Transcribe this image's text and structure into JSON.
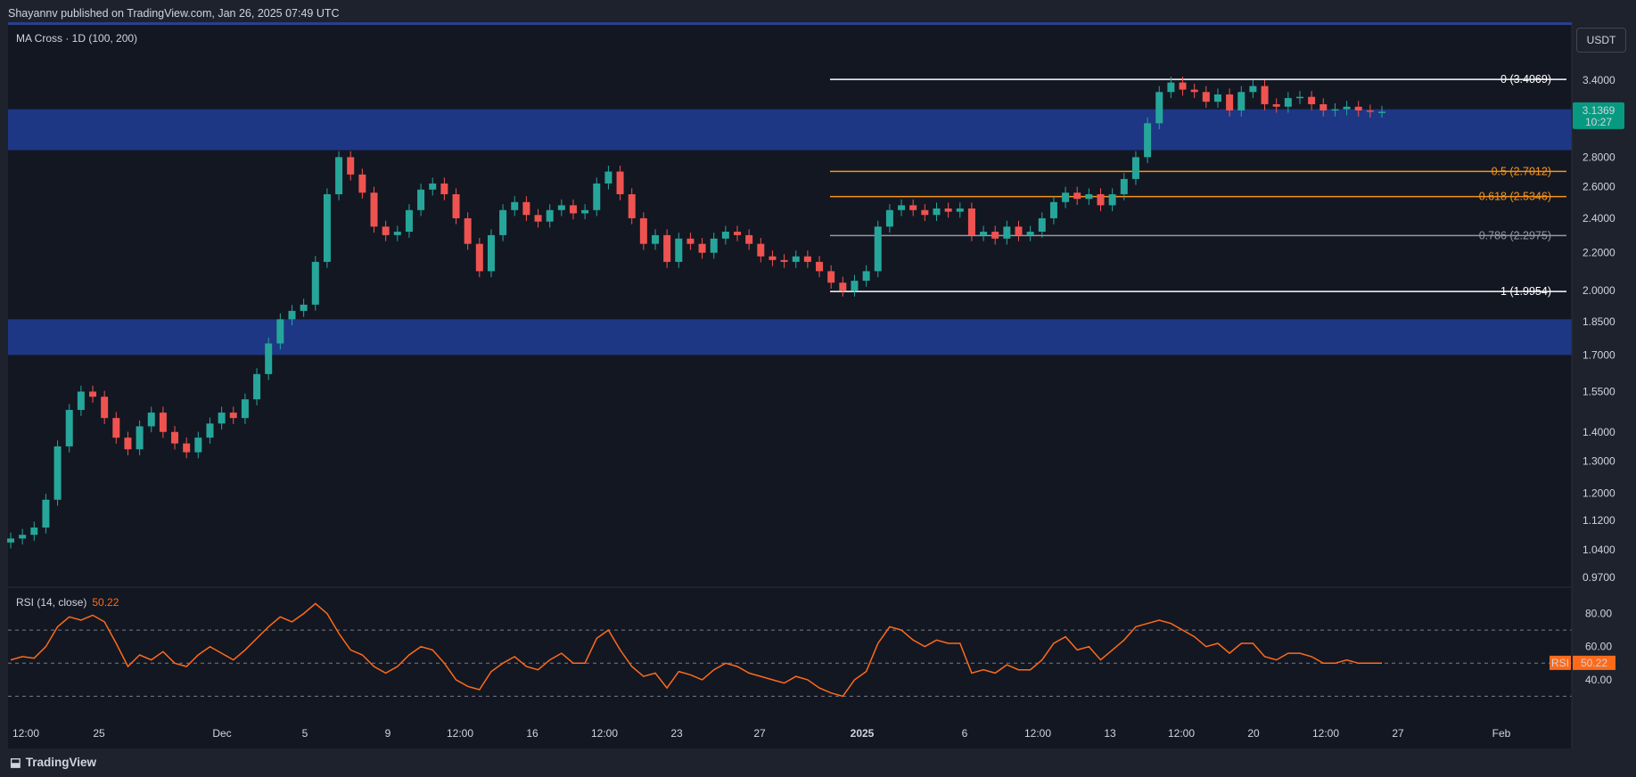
{
  "header": {
    "publish_text": "Shayannv published on TradingView.com, Jan 26, 2025 07:49 UTC"
  },
  "currency_button": "USDT",
  "indicator_label": "MA Cross · 1D (100, 200)",
  "rsi": {
    "label": "RSI (14, close)",
    "value": "50.22",
    "badge_label": "RSI",
    "badge_value": "50.22"
  },
  "footer": {
    "brand": "TradingView"
  },
  "colors": {
    "background": "#131722",
    "panel": "#1e222d",
    "zone": "#1f3b8f",
    "up": "#26a69a",
    "down": "#ef5350",
    "fib_white": "#ffffff",
    "fib_orange": "#f7931a",
    "fib_gray": "#9598a1",
    "rsi_line": "#ff6a1a",
    "price_tag": "#089981"
  },
  "chart_data": {
    "type": "candlestick",
    "price_axis": {
      "ticks": [
        "3.4000",
        "2.8000",
        "2.6000",
        "2.4000",
        "2.2000",
        "2.0000",
        "1.8500",
        "1.7000",
        "1.5500",
        "1.4000",
        "1.3000",
        "1.2000",
        "1.1200",
        "1.0400",
        "0.9700"
      ],
      "scale": "log"
    },
    "time_axis": {
      "ticks": [
        "12:00",
        "25",
        "Dec",
        "5",
        "9",
        "12:00",
        "16",
        "12:00",
        "23",
        "27",
        "2025",
        "6",
        "12:00",
        "13",
        "12:00",
        "20",
        "12:00",
        "27",
        "Feb"
      ]
    },
    "current_price": {
      "value": "3.1369",
      "countdown": "10:27"
    },
    "zones": [
      {
        "name": "resistance-zone",
        "from": 2.85,
        "to": 3.16
      },
      {
        "name": "support-zone",
        "from": 1.7,
        "to": 1.86
      }
    ],
    "fibonacci": [
      {
        "label": "0 (3.4069)",
        "price": 3.4069,
        "color": "white"
      },
      {
        "label": "0.5 (2.7012)",
        "price": 2.7012,
        "color": "orange"
      },
      {
        "label": "0.618 (2.5346)",
        "price": 2.5346,
        "color": "orange"
      },
      {
        "label": "0.786 (2.2975)",
        "price": 2.2975,
        "color": "gray"
      },
      {
        "label": "1 (1.9954)",
        "price": 1.9954,
        "color": "white"
      }
    ],
    "series": [
      {
        "name": "price",
        "close_path": [
          1.07,
          1.08,
          1.1,
          1.18,
          1.35,
          1.48,
          1.55,
          1.53,
          1.45,
          1.38,
          1.34,
          1.42,
          1.47,
          1.4,
          1.36,
          1.33,
          1.38,
          1.43,
          1.47,
          1.45,
          1.52,
          1.62,
          1.75,
          1.86,
          1.9,
          1.93,
          2.15,
          2.55,
          2.8,
          2.68,
          2.56,
          2.35,
          2.3,
          2.32,
          2.45,
          2.58,
          2.62,
          2.55,
          2.4,
          2.25,
          2.1,
          2.3,
          2.45,
          2.5,
          2.42,
          2.38,
          2.45,
          2.48,
          2.43,
          2.45,
          2.62,
          2.7,
          2.55,
          2.4,
          2.25,
          2.3,
          2.15,
          2.28,
          2.25,
          2.2,
          2.28,
          2.32,
          2.3,
          2.25,
          2.18,
          2.16,
          2.15,
          2.18,
          2.15,
          2.1,
          2.04,
          2.0,
          2.05,
          2.1,
          2.35,
          2.45,
          2.48,
          2.45,
          2.42,
          2.46,
          2.44,
          2.46,
          2.3,
          2.32,
          2.28,
          2.35,
          2.3,
          2.32,
          2.4,
          2.5,
          2.56,
          2.52,
          2.55,
          2.48,
          2.55,
          2.65,
          2.8,
          3.05,
          3.3,
          3.38,
          3.32,
          3.3,
          3.22,
          3.28,
          3.15,
          3.3,
          3.35,
          3.2,
          3.18,
          3.25,
          3.26,
          3.2,
          3.15,
          3.16,
          3.18,
          3.15,
          3.14,
          3.14
        ]
      },
      {
        "name": "RSI",
        "axis_ticks": [
          "80.00",
          "60.00",
          "40.00"
        ],
        "levels": [
          70,
          50,
          30
        ],
        "values": [
          52,
          54,
          53,
          60,
          72,
          78,
          76,
          79,
          75,
          62,
          48,
          55,
          52,
          57,
          50,
          48,
          55,
          60,
          56,
          52,
          58,
          65,
          72,
          78,
          75,
          80,
          86,
          80,
          68,
          58,
          55,
          48,
          44,
          48,
          55,
          60,
          58,
          50,
          40,
          36,
          34,
          45,
          50,
          54,
          48,
          46,
          52,
          56,
          50,
          50,
          65,
          70,
          58,
          48,
          42,
          44,
          35,
          45,
          43,
          40,
          46,
          50,
          48,
          44,
          42,
          40,
          38,
          42,
          40,
          35,
          32,
          30,
          40,
          45,
          62,
          72,
          70,
          64,
          60,
          64,
          62,
          62,
          44,
          46,
          44,
          49,
          46,
          46,
          52,
          62,
          66,
          58,
          60,
          52,
          58,
          64,
          72,
          74,
          76,
          74,
          70,
          66,
          60,
          62,
          56,
          62,
          62,
          54,
          52,
          56,
          56,
          54,
          50,
          50,
          52,
          50,
          50,
          50
        ]
      }
    ]
  }
}
